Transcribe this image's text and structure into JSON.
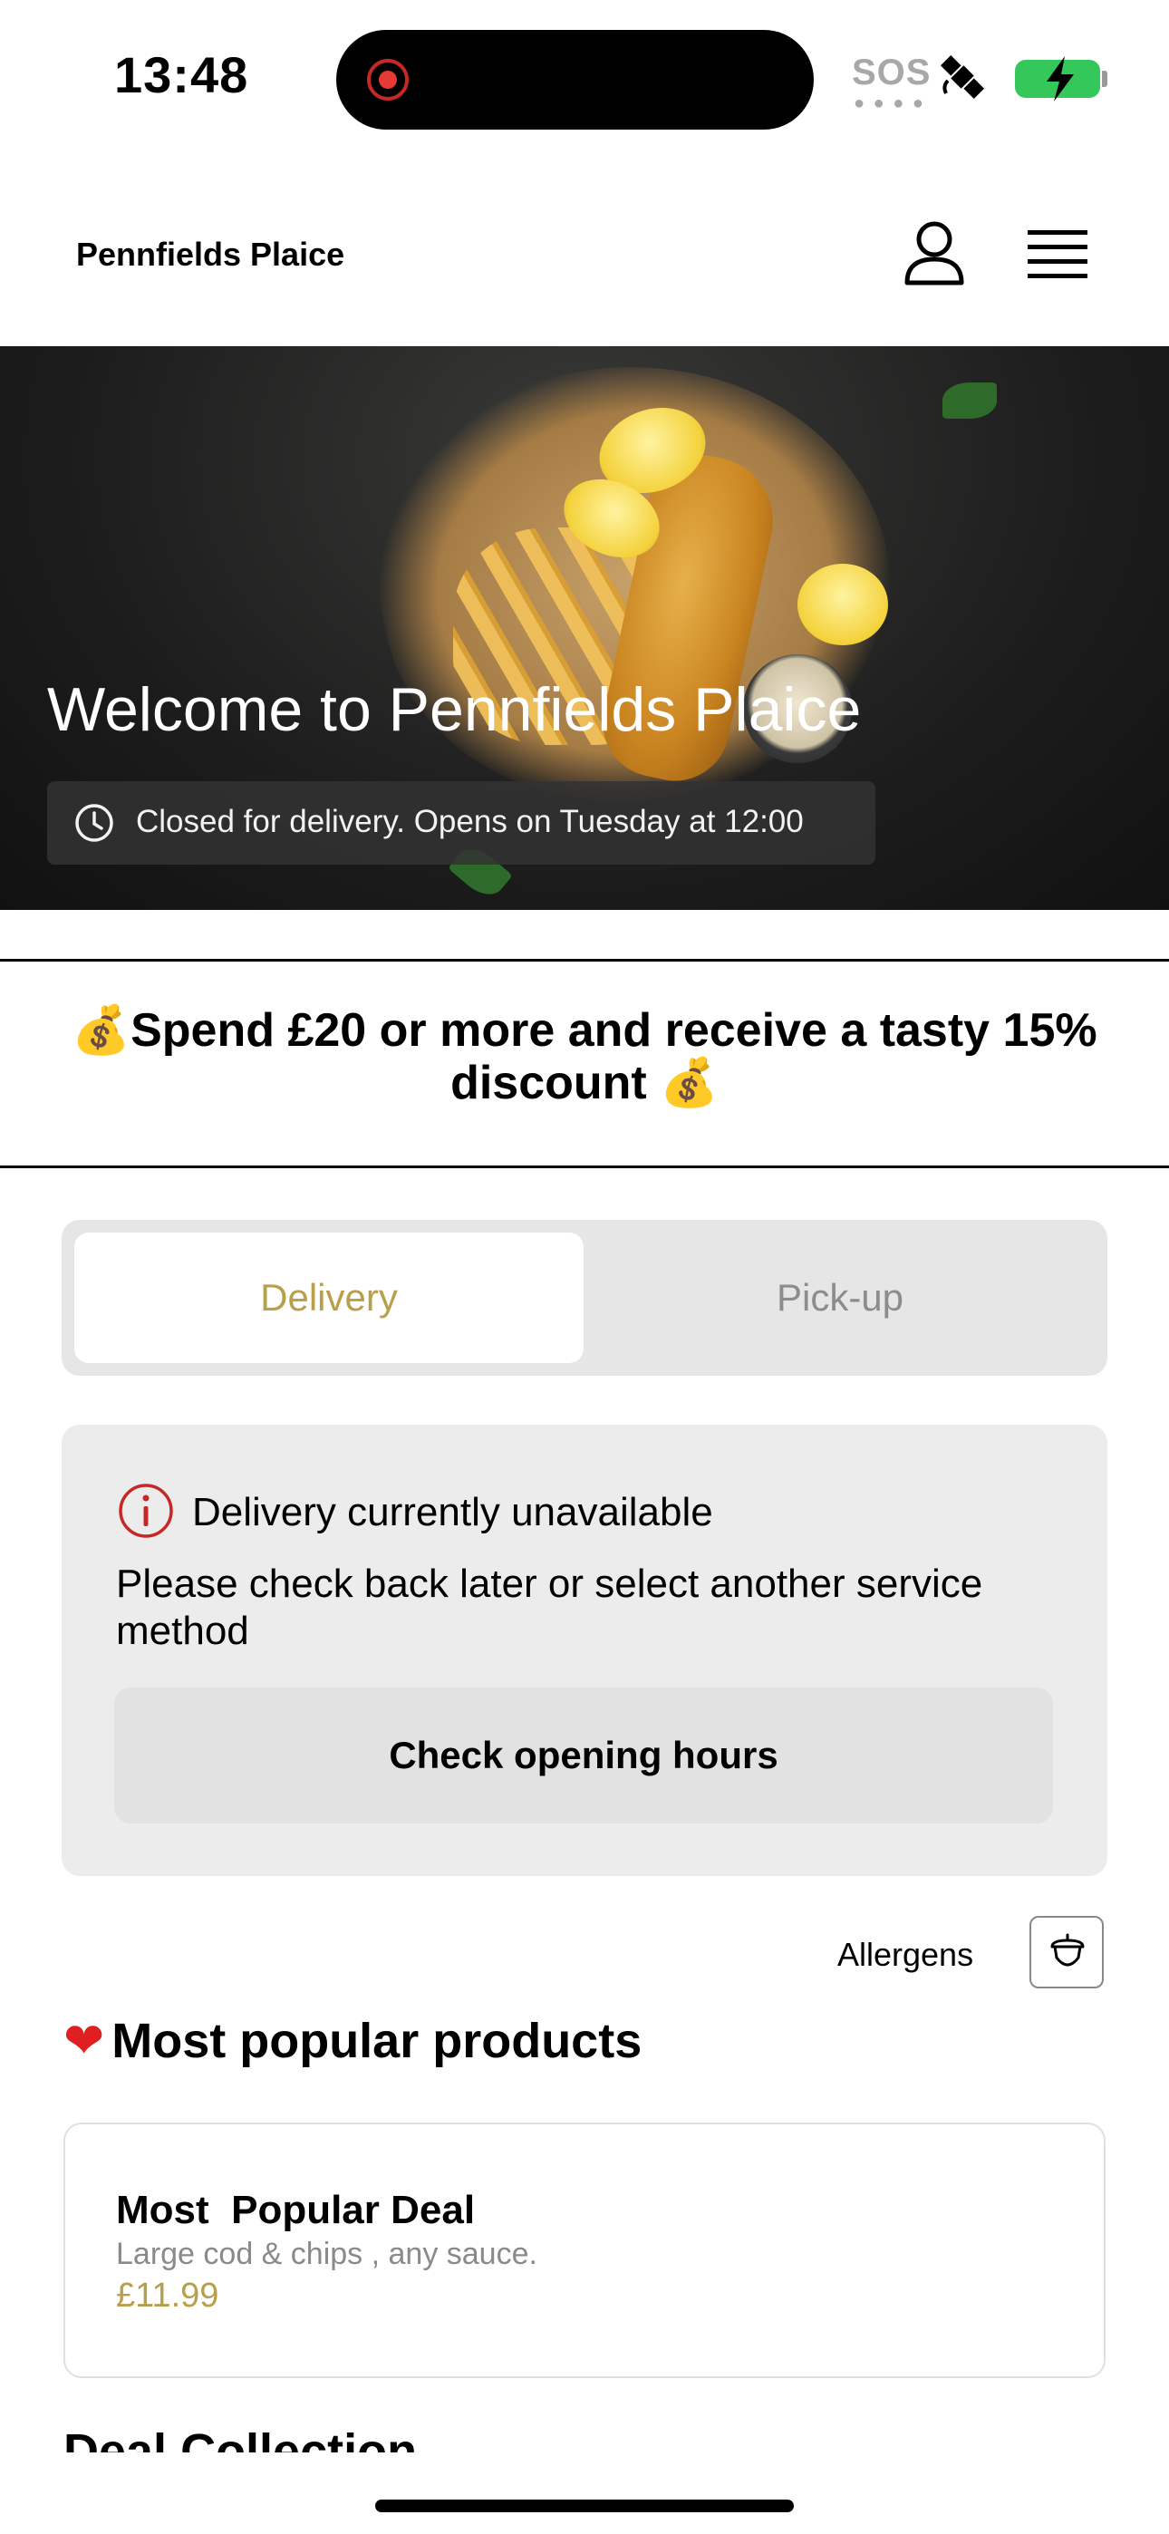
{
  "status_bar": {
    "time": "13:48",
    "sos": "SOS",
    "icons": [
      "screen-record-icon",
      "satellite-icon",
      "battery-charging-icon"
    ]
  },
  "header": {
    "brand": "Pennfields Plaice",
    "icons": [
      "user-icon",
      "menu-icon"
    ]
  },
  "hero": {
    "title": "Welcome to Pennfields Plaice",
    "status": "Closed for delivery. Opens on Tuesday at 12:00"
  },
  "promo": {
    "text": "💰Spend £20 or more and receive a tasty 15% discount 💰"
  },
  "service_tabs": [
    {
      "label": "Delivery",
      "active": true
    },
    {
      "label": "Pick-up",
      "active": false
    }
  ],
  "availability": {
    "title": "Delivery currently unavailable",
    "message": "Please check back later or select another service method",
    "button": "Check opening hours"
  },
  "allergens": {
    "label": "Allergens"
  },
  "popular": {
    "title": "Most popular products",
    "products": [
      {
        "name": "Most  Popular Deal",
        "description": "Large cod & chips , any sauce.",
        "price": "£11.99"
      }
    ]
  },
  "next_section": {
    "title": "Deal Collection"
  },
  "colors": {
    "accent_gold": "#b8a04a",
    "tab_background": "#e6e6e6",
    "card_background": "#ececec",
    "alert_red": "#c62828"
  }
}
